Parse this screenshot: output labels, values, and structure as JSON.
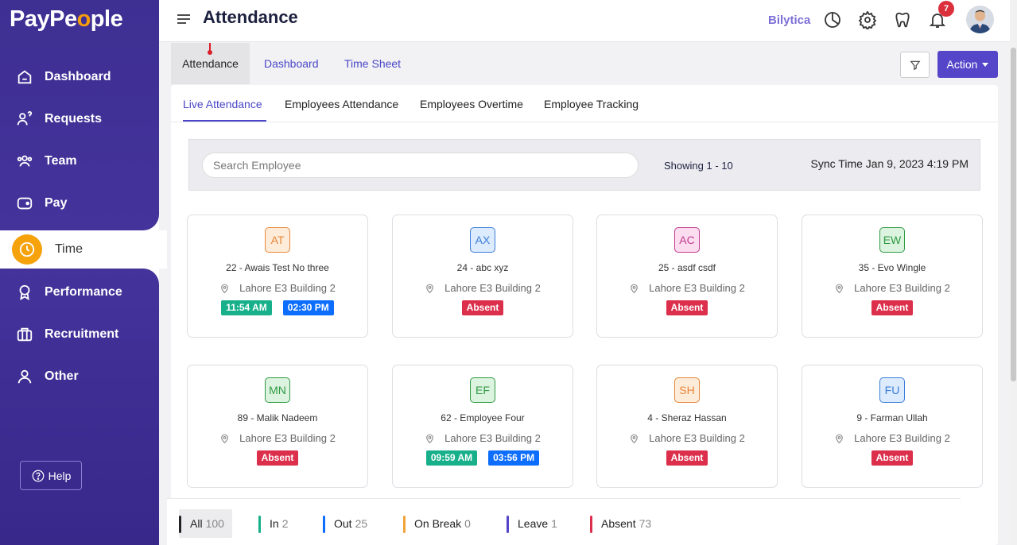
{
  "brand": {
    "name_a": "PayPe",
    "name_o": "o",
    "name_b": "ple"
  },
  "sidebar": {
    "items": [
      {
        "label": "Dashboard",
        "icon": "home-icon"
      },
      {
        "label": "Requests",
        "icon": "requests-icon"
      },
      {
        "label": "Team",
        "icon": "team-icon"
      },
      {
        "label": "Pay",
        "icon": "wallet-icon"
      },
      {
        "label": "Time",
        "icon": "clock-icon",
        "active": true
      },
      {
        "label": "Performance",
        "icon": "award-icon"
      },
      {
        "label": "Recruitment",
        "icon": "briefcase-icon"
      },
      {
        "label": "Other",
        "icon": "user-icon"
      }
    ],
    "help_label": "Help"
  },
  "header": {
    "title": "Attendance",
    "company": "Bilytica",
    "notification_count": "7"
  },
  "top_tabs": [
    "Attendance",
    "Dashboard",
    "Time Sheet"
  ],
  "action_label": "Action",
  "sub_tabs": [
    "Live Attendance",
    "Employees Attendance",
    "Employees Overtime",
    "Employee Tracking"
  ],
  "search": {
    "placeholder": "Search Employee",
    "showing": "Showing 1 - 10",
    "sync": "Sync Time Jan 9, 2023 4:19 PM"
  },
  "employees": [
    {
      "initials": "AT",
      "name": "22 - Awais Test No three",
      "location": "Lahore E3 Building 2",
      "status": [
        "11:54 AM",
        "02:30 PM"
      ],
      "color": "#e8863a",
      "bg": "#fdecd9"
    },
    {
      "initials": "AX",
      "name": "24 - abc xyz",
      "location": "Lahore E3 Building 2",
      "status": [
        "Absent"
      ],
      "color": "#3b7dd8",
      "bg": "#dcebfd"
    },
    {
      "initials": "AC",
      "name": "25 - asdf csdf",
      "location": "Lahore E3 Building 2",
      "status": [
        "Absent"
      ],
      "color": "#c23a8e",
      "bg": "#fcdcef"
    },
    {
      "initials": "EW",
      "name": "35 - Evo Wingle",
      "location": "Lahore E3 Building 2",
      "status": [
        "Absent"
      ],
      "color": "#2f9a44",
      "bg": "#dcf3df"
    },
    {
      "initials": "MN",
      "name": "89 - Malik Nadeem",
      "location": "Lahore E3 Building 2",
      "status": [
        "Absent"
      ],
      "color": "#2f9a44",
      "bg": "#dcf3df"
    },
    {
      "initials": "EF",
      "name": "62 - Employee Four",
      "location": "Lahore E3 Building 2",
      "status": [
        "09:59 AM",
        "03:56 PM"
      ],
      "color": "#2f9a44",
      "bg": "#dcf3df"
    },
    {
      "initials": "SH",
      "name": "4 - Sheraz Hassan",
      "location": "Lahore E3 Building 2",
      "status": [
        "Absent"
      ],
      "color": "#e8863a",
      "bg": "#fdecd9"
    },
    {
      "initials": "FU",
      "name": "9 - Farman Ullah",
      "location": "Lahore E3 Building 2",
      "status": [
        "Absent"
      ],
      "color": "#3b7dd8",
      "bg": "#dcebfd"
    }
  ],
  "legend": [
    {
      "label": "All",
      "count": "100",
      "color": "#222222"
    },
    {
      "label": "In",
      "count": "2",
      "color": "#17b08a"
    },
    {
      "label": "Out",
      "count": "25",
      "color": "#0d6efd"
    },
    {
      "label": "On Break",
      "count": "0",
      "color": "#f0a33a"
    },
    {
      "label": "Leave",
      "count": "1",
      "color": "#5546c9"
    },
    {
      "label": "Absent",
      "count": "73",
      "color": "#dc2f4c"
    }
  ]
}
